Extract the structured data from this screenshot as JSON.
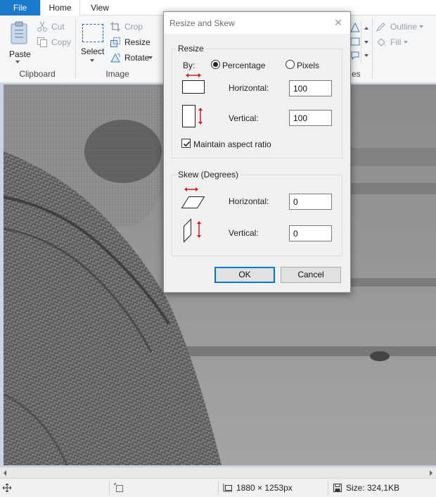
{
  "tabs": {
    "file": "File",
    "home": "Home",
    "view": "View"
  },
  "ribbon": {
    "clipboard": {
      "label": "Clipboard",
      "paste": "Paste",
      "cut": "Cut",
      "copy": "Copy"
    },
    "image": {
      "label": "Image",
      "select": "Select",
      "crop": "Crop",
      "resize": "Resize",
      "rotate": "Rotate"
    },
    "shapes": {
      "label_fragment": "es",
      "outline": "Outline",
      "fill": "Fill"
    }
  },
  "dialog": {
    "title": "Resize and Skew",
    "resize": {
      "legend": "Resize",
      "by_label": "By:",
      "percentage": "Percentage",
      "pixels": "Pixels",
      "selected_unit": "Percentage",
      "horizontal_label": "Horizontal:",
      "horizontal_value": "100",
      "vertical_label": "Vertical:",
      "vertical_value": "100",
      "maintain_aspect": "Maintain aspect ratio",
      "maintain_aspect_checked": true
    },
    "skew": {
      "legend": "Skew (Degrees)",
      "horizontal_label": "Horizontal:",
      "horizontal_value": "0",
      "vertical_label": "Vertical:",
      "vertical_value": "0"
    },
    "ok": "OK",
    "cancel": "Cancel"
  },
  "status": {
    "dimensions": "1880 × 1253px",
    "size": "Size: 324,1KB"
  },
  "colors": {
    "file_tab": "#1979ca",
    "accent_arrow": "#d01e1e",
    "canvas_bg": "#c9d3e1"
  }
}
